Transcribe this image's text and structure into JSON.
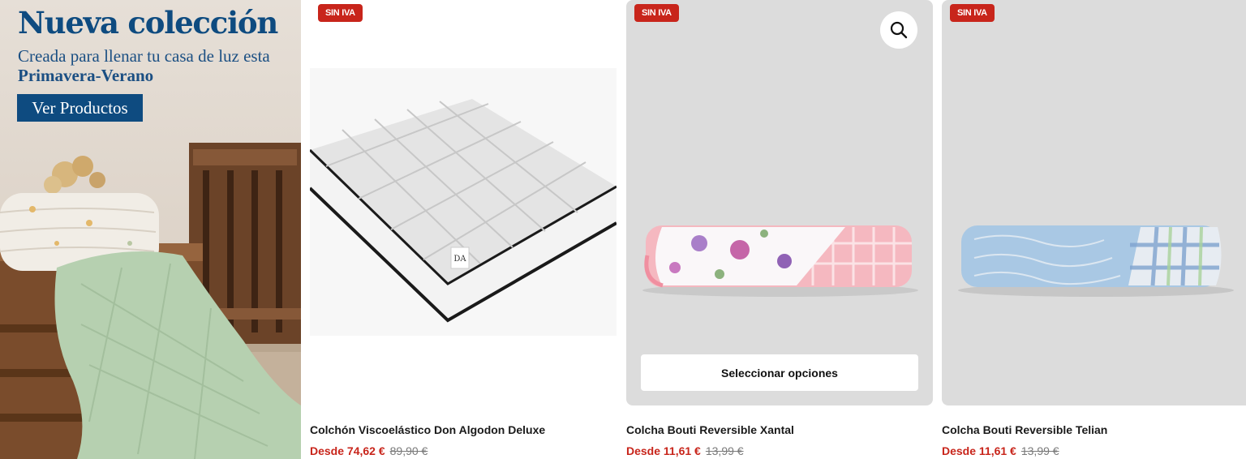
{
  "promo": {
    "title": "Nueva colección",
    "subtitle": "Creada para llenar tu casa de luz esta",
    "subtitle_bold": "Primavera-Verano",
    "button": "Ver Productos"
  },
  "products": [
    {
      "badge": "SIN IVA",
      "name": "Colchón Viscoelástico Don Algodon Deluxe",
      "price": "Desde 74,62 €",
      "old_price": "89,90 €",
      "image": "mattress"
    },
    {
      "badge": "SIN IVA",
      "name": "Colcha Bouti Reversible Xantal",
      "price": "Desde 11,61 €",
      "old_price": "13,99 €",
      "image": "floral-quilt",
      "action_button": "Seleccionar opciones",
      "quick_view_icon": "search-icon"
    },
    {
      "badge": "SIN IVA",
      "name": "Colcha Bouti Reversible Telian",
      "price": "Desde 11,61 €",
      "old_price": "13,99 €",
      "image": "blue-quilt"
    }
  ],
  "colors": {
    "brand_blue": "#0e4b80",
    "sale_red": "#c8251b",
    "card_grey": "#dcdcdc"
  }
}
